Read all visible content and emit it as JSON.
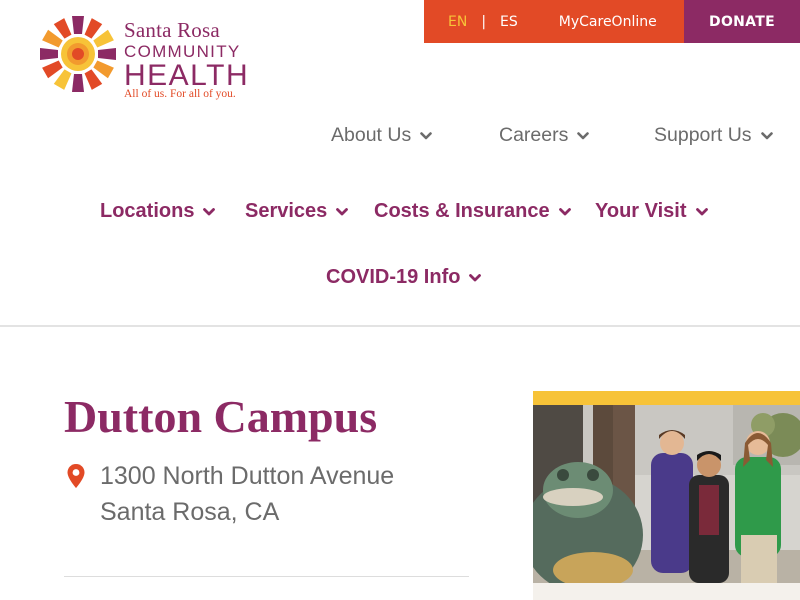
{
  "logo": {
    "line1": "Santa Rosa",
    "line2": "COMMUNITY",
    "line3": "HEALTH",
    "tagline": "All of us. For all of you."
  },
  "utility": {
    "lang_en": "EN",
    "separator": "|",
    "lang_es": "ES",
    "mycare": "MyCareOnline",
    "donate": "DONATE"
  },
  "secondary_nav": [
    {
      "label": "About Us",
      "icon": "chevron-down-icon"
    },
    {
      "label": "Careers",
      "icon": "chevron-down-icon"
    },
    {
      "label": "Support Us",
      "icon": "chevron-down-icon"
    }
  ],
  "main_nav": [
    {
      "label": "Locations",
      "icon": "chevron-down-icon"
    },
    {
      "label": "Services",
      "icon": "chevron-down-icon"
    },
    {
      "label": "Costs & Insurance",
      "icon": "chevron-down-icon"
    },
    {
      "label": "Your Visit",
      "icon": "chevron-down-icon"
    },
    {
      "label": "COVID-19 Info",
      "icon": "chevron-down-icon"
    }
  ],
  "page": {
    "title": "Dutton Campus",
    "address_line1": "1300 North Dutton Avenue",
    "address_line2": "Santa Rosa, CA",
    "address_icon": "map-pin-icon"
  },
  "colors": {
    "brand_purple": "#8c2a64",
    "brand_orange": "#e24a26",
    "brand_yellow": "#f7c338",
    "text_gray": "#6b6b6b"
  }
}
